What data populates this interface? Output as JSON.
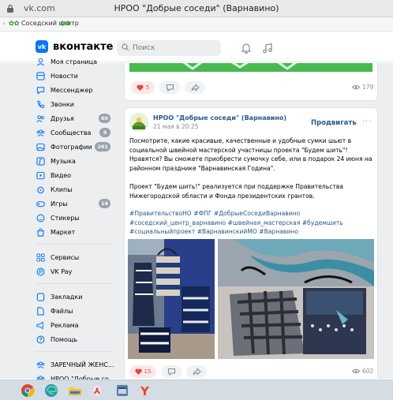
{
  "browser": {
    "url": "vk.com",
    "window_title": "НРОО \"Добрые соседи\" (Варнавино)",
    "bookmark_label": "Соседский центр",
    "bookmark_flowers": "✿✿"
  },
  "header": {
    "logo_text": "вконтакте",
    "logo_mark": "vk",
    "search_placeholder": "Поиск"
  },
  "sidebar": {
    "items": [
      {
        "label": "Моя страница",
        "icon": "user-icon"
      },
      {
        "label": "Новости",
        "icon": "news-icon"
      },
      {
        "label": "Мессенджер",
        "icon": "message-icon"
      },
      {
        "label": "Звонки",
        "icon": "phone-icon"
      },
      {
        "label": "Друзья",
        "icon": "friends-icon",
        "badge": "60"
      },
      {
        "label": "Сообщества",
        "icon": "communities-icon",
        "badge": "9"
      },
      {
        "label": "Фотографии",
        "icon": "photo-icon",
        "badge": "261"
      },
      {
        "label": "Музыка",
        "icon": "music-icon"
      },
      {
        "label": "Видео",
        "icon": "video-icon"
      },
      {
        "label": "Клипы",
        "icon": "clips-icon"
      },
      {
        "label": "Игры",
        "icon": "games-icon",
        "badge": "14"
      },
      {
        "label": "Стикеры",
        "icon": "stickers-icon"
      },
      {
        "label": "Маркет",
        "icon": "market-icon"
      }
    ],
    "items2": [
      {
        "label": "Сервисы",
        "icon": "services-icon"
      },
      {
        "label": "VK Pay",
        "icon": "vkpay-icon"
      }
    ],
    "items3": [
      {
        "label": "Закладки",
        "icon": "bookmark-icon"
      },
      {
        "label": "Файлы",
        "icon": "file-icon"
      },
      {
        "label": "Реклама",
        "icon": "ads-icon"
      },
      {
        "label": "Помощь",
        "icon": "help-icon"
      }
    ],
    "groups": [
      {
        "label": "ЗАРЕЧНЫЙ ЖЕНС...",
        "icon": "group-icon"
      },
      {
        "label": "НРОО \"Добрые со...",
        "icon": "group-icon"
      }
    ]
  },
  "post1": {
    "likes": "5",
    "views": "179"
  },
  "post2": {
    "author": "НРОО \"Добрые соседи\" (Варнавино)",
    "date": "21 мая в 20:25",
    "follow_label": "Продвигать",
    "text1": "Посмотрите, какие красивые, качественные и удобные сумки шьют в социальной швейной мастерской участницы проекта \"Будем шить\"! Нравятся? Вы сможете приобрести сумочку себе, или в подарок 24 июня на районном празднике \"Варнавинская Година\".",
    "text2": "Проект \"Будем шить!\" реализуется при поддержке Правительства Нижегородской области и Фонда президентских грантов.",
    "tags": "#ПравительствоНО #ФПГ #ДобрыеСоседиВарнавино #соседский_центр_варнавино #швейная_мастерская #будемшить #социальныйпроект #ВарнавинскийМО #Варнавино",
    "likes": "15",
    "views": "602"
  },
  "colors": {
    "accent": "#0077ff",
    "link": "#2a5885",
    "like": "#e64646",
    "background": "#edeef0"
  },
  "taskbar_icons": [
    "chrome-icon",
    "edge-icon",
    "explorer-icon",
    "paint-icon",
    "app-icon",
    "yandex-icon"
  ]
}
